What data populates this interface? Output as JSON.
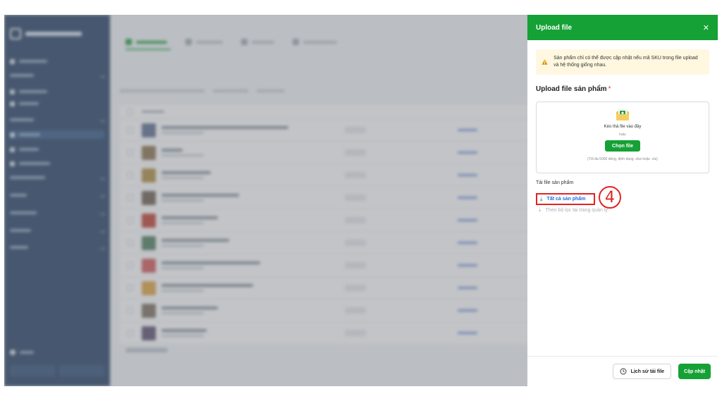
{
  "drawer": {
    "title": "Upload file",
    "close_icon": "close-icon",
    "warning_text": "Sản phẩm chỉ có thể được cập nhật nếu mã SKU trong file upload và hệ thống giống nhau.",
    "upload_section_title": "Upload file sản phẩm",
    "required_mark": "*",
    "dropzone": {
      "drag_text": "Kéo thả file vào đây",
      "or_text": "hoặc",
      "choose_button": "Chọn file",
      "note": "(Tối đa 5000 dòng, định dạng .xlsx hoặc .xls)"
    },
    "download_section_title": "Tải file sản phẩm",
    "download_all": "Tất cả sản phẩm",
    "download_filtered": "Theo bộ lọc tại trang quản lý",
    "history_button": "Lịch sử tải file",
    "update_button": "Cập nhật"
  },
  "annotation": {
    "step_number": "4"
  },
  "colors": {
    "brand_green": "#15a135",
    "sidebar_navy": "#1f3a5f",
    "highlight_red": "#e02424",
    "link_blue": "#1f6fd6"
  }
}
